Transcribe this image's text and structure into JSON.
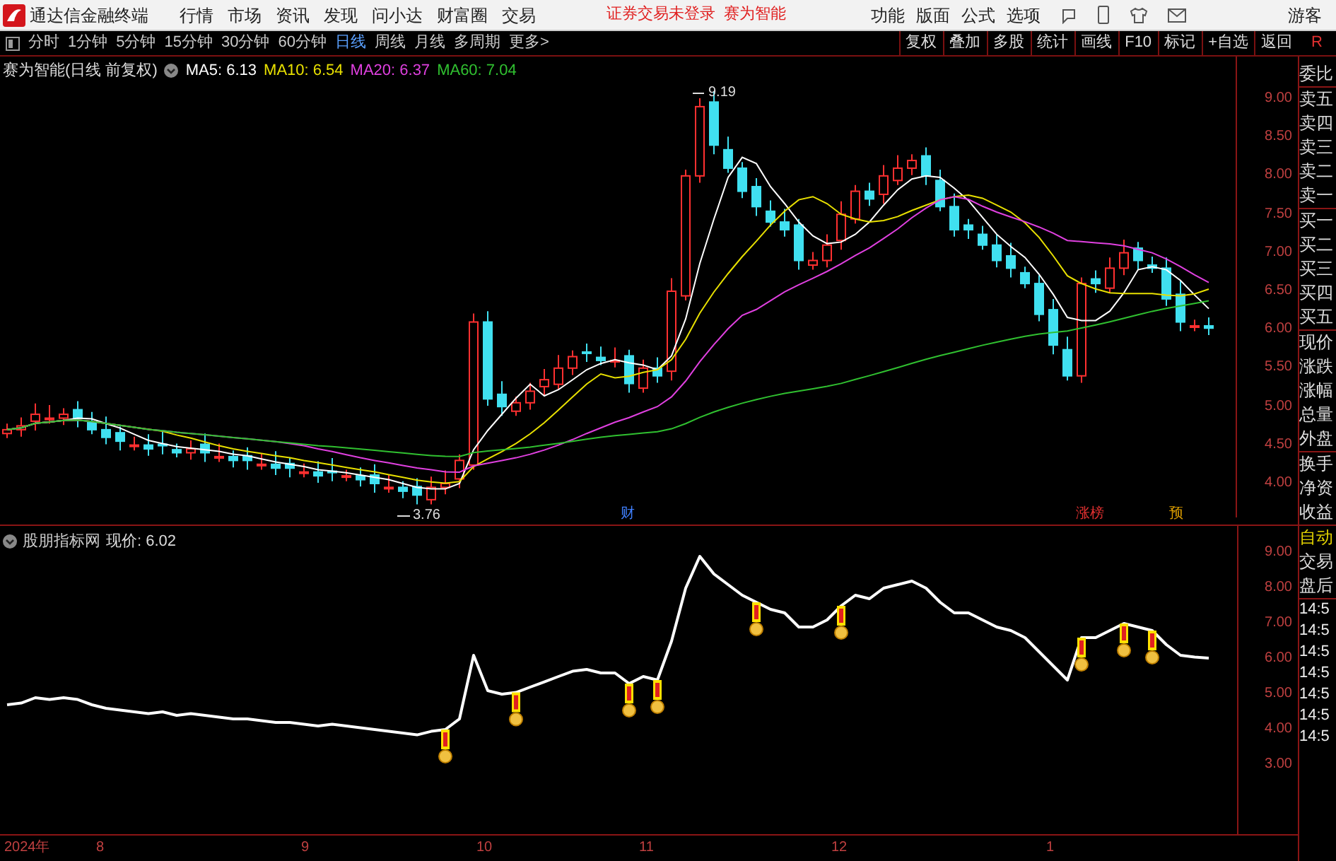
{
  "app": {
    "title": "通达信金融终端",
    "menus": [
      "行情",
      "市场",
      "资讯",
      "发现",
      "问小达",
      "财富圈",
      "交易"
    ],
    "notices": [
      "证券交易未登录",
      "赛为智能"
    ],
    "tools": [
      "功能",
      "版面",
      "公式",
      "选项"
    ],
    "user": "游客"
  },
  "periods": [
    {
      "label": "分时",
      "selected": false
    },
    {
      "label": "1分钟",
      "selected": false
    },
    {
      "label": "5分钟",
      "selected": false
    },
    {
      "label": "15分钟",
      "selected": false
    },
    {
      "label": "30分钟",
      "selected": false
    },
    {
      "label": "60分钟",
      "selected": false
    },
    {
      "label": "日线",
      "selected": true
    },
    {
      "label": "周线",
      "selected": false
    },
    {
      "label": "月线",
      "selected": false
    },
    {
      "label": "多周期",
      "selected": false
    },
    {
      "label": "更多>",
      "selected": false
    }
  ],
  "actions": [
    "复权",
    "叠加",
    "多股",
    "统计",
    "画线",
    "F10",
    "标记",
    "+自选",
    "返回"
  ],
  "corner": "R",
  "main_chart": {
    "title": "赛为智能(日线 前复权)",
    "averages": [
      {
        "label": "MA5: 6.13",
        "color": "#ffffff"
      },
      {
        "label": "MA10: 6.54",
        "color": "#e8e000"
      },
      {
        "label": "MA20: 6.37",
        "color": "#e040e0"
      },
      {
        "label": "MA60: 7.04",
        "color": "#30c030"
      }
    ],
    "high_label": "9.19",
    "low_label": "3.76",
    "events": [
      {
        "label": "财",
        "color": "#4080ff"
      },
      {
        "label": "涨榜",
        "color": "#e03030"
      },
      {
        "label": "预",
        "color": "#e0a000"
      }
    ],
    "price_axis": [
      "9.00",
      "8.50",
      "8.00",
      "7.50",
      "7.00",
      "6.50",
      "6.00",
      "5.50",
      "5.00",
      "4.50",
      "4.00"
    ]
  },
  "indicator": {
    "title": "股朋指标网",
    "reading": "现价: 6.02",
    "chart_data": {
      "type": "line",
      "ylim": [
        1.04,
        9.76
      ],
      "yticks": [
        {
          "value": 9,
          "label": "9.00"
        },
        {
          "value": 8,
          "label": "8.00"
        },
        {
          "value": 7,
          "label": "7.00"
        },
        {
          "value": 6,
          "label": "6.00"
        },
        {
          "value": 5,
          "label": "5.00"
        },
        {
          "value": 4,
          "label": "4.00"
        },
        {
          "value": 3,
          "label": "3.00"
        }
      ],
      "series": [
        {
          "color": "#ffffff",
          "values": [
            4.7,
            4.75,
            4.9,
            4.85,
            4.9,
            4.85,
            4.7,
            4.6,
            4.55,
            4.5,
            4.45,
            4.5,
            4.4,
            4.45,
            4.4,
            4.35,
            4.3,
            4.3,
            4.25,
            4.2,
            4.2,
            4.15,
            4.1,
            4.15,
            4.1,
            4.05,
            4.0,
            3.95,
            3.9,
            3.85,
            3.95,
            4.0,
            4.3,
            6.1,
            5.1,
            5.0,
            5.05,
            5.2,
            5.35,
            5.5,
            5.65,
            5.7,
            5.6,
            5.6,
            5.3,
            5.5,
            5.4,
            6.5,
            8.0,
            8.9,
            8.4,
            8.1,
            7.8,
            7.6,
            7.4,
            7.3,
            6.9,
            6.9,
            7.1,
            7.5,
            7.8,
            7.7,
            8.0,
            8.1,
            8.2,
            8.0,
            7.6,
            7.3,
            7.3,
            7.1,
            6.9,
            6.8,
            6.6,
            6.2,
            5.8,
            5.4,
            6.6,
            6.6,
            6.8,
            7.0,
            6.9,
            6.8,
            6.4,
            6.1,
            6.05,
            6.02
          ]
        }
      ]
    }
  },
  "date_axis": [
    "2024年",
    "8",
    "9",
    "10",
    "11",
    "12",
    "1"
  ],
  "quote_panel": [
    [
      "委比"
    ],
    [
      "卖五",
      "卖四",
      "卖三",
      "卖二",
      "卖一"
    ],
    [
      "买一",
      "买二",
      "买三",
      "买四",
      "买五"
    ],
    [
      "现价",
      "涨跌",
      "涨幅",
      "总量",
      "外盘"
    ],
    [
      "换手",
      "净资",
      "收益"
    ]
  ],
  "trade_tabs": [
    {
      "label": "自动",
      "selected": true
    },
    {
      "label": "交易",
      "selected": false
    },
    {
      "label": "盘后",
      "selected": false
    }
  ],
  "ticks": [
    "14:5",
    "14:5",
    "14:5",
    "14:5",
    "14:5",
    "14:5",
    "14:5"
  ]
}
